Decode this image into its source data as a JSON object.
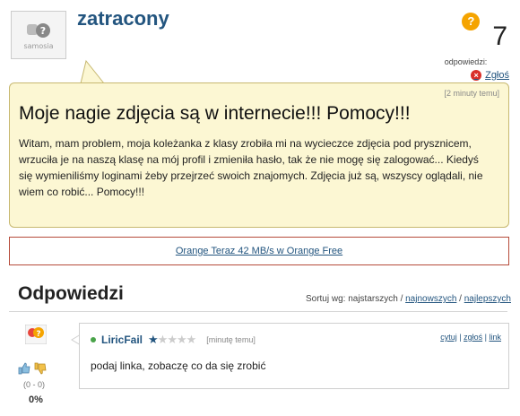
{
  "user": {
    "username": "zatracony",
    "avatar_label": "samosia"
  },
  "answers_counter": {
    "label": "odpowiedzi:",
    "count": "7"
  },
  "report_label": "Zgłoś",
  "question": {
    "time": "[2 minuty temu]",
    "title": "Moje nagie zdjęcia są w internecie!!! Pomocy!!!",
    "body": "Witam, mam problem, moja koleżanka z klasy zrobiła mi na wycieczce zdjęcia pod prysznicem, wrzuciła je na naszą klasę na mój profil i zmieniła hasło, tak że nie mogę się zalogować... Kiedyś się wymieniliśmy loginami żeby przejrzeć swoich znajomych. Zdjęcia już są, wszyscy oglądali, nie wiem co robić... Pomocy!!!"
  },
  "ad_link": "Orange Teraz 42 MB/s w Orange Free",
  "answers_section": {
    "title": "Odpowiedzi",
    "sort_label": "Sortuj wg: najstarszych /",
    "sort_newest": "najnowszych",
    "sort_separator": "/",
    "sort_best": "najlepszych"
  },
  "answer": {
    "author": "LiricFail",
    "rating_stars": 1,
    "rating_max": 5,
    "time": "[minutę temu]",
    "link_quote": "cytuj",
    "link_report": "zgłoś",
    "link_link": "link",
    "sep": "|",
    "text": "podaj linka, zobaczę co da się zrobić",
    "votes": "(0 - 0)",
    "percent": "0%"
  },
  "colors": {
    "link": "#23557f",
    "bubble_bg": "#fcf7d3",
    "bubble_border": "#c7b870",
    "accent_orange": "#f5a400",
    "report_red": "#d9302a"
  }
}
